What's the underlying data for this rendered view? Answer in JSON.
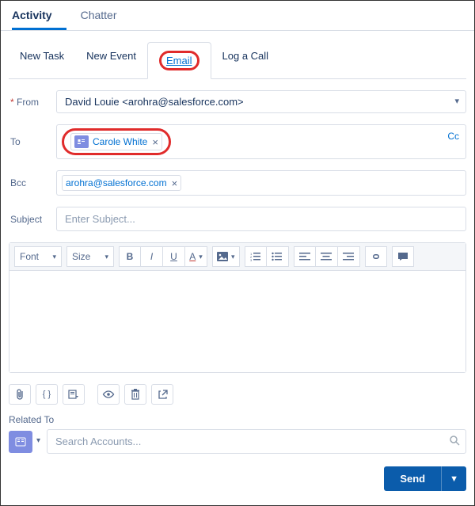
{
  "topTabs": {
    "activity": "Activity",
    "chatter": "Chatter"
  },
  "subTabs": {
    "newTask": "New Task",
    "newEvent": "New Event",
    "email": "Email",
    "logCall": "Log a Call"
  },
  "form": {
    "fromLabel": "From",
    "fromValue": "David Louie <arohra@salesforce.com>",
    "toLabel": "To",
    "toPill": "Carole White",
    "ccLabel": "Cc",
    "bccLabel": "Bcc",
    "bccPill": "arohra@salesforce.com",
    "subjectLabel": "Subject",
    "subjectPlaceholder": "Enter Subject..."
  },
  "toolbar": {
    "font": "Font",
    "size": "Size"
  },
  "related": {
    "label": "Related To",
    "placeholder": "Search Accounts..."
  },
  "footer": {
    "send": "Send"
  }
}
